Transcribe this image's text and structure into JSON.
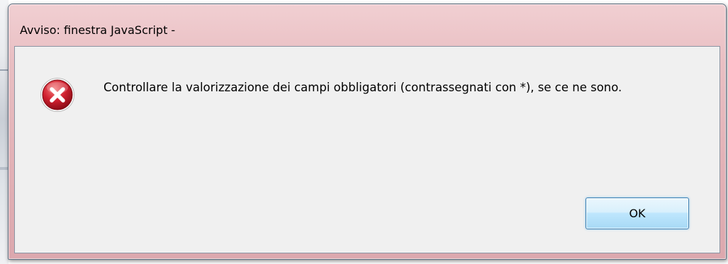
{
  "dialog": {
    "title": "Avviso: finestra JavaScript -",
    "message": "Controllare la valorizzazione dei campi obbligatori (contrassegnati con *), se ce ne sono.",
    "icon": "error-icon",
    "ok_label": "OK"
  },
  "colors": {
    "titlebar": "#e6b8bc",
    "client_background": "#f0f0f0",
    "error_icon_red": "#c8102e",
    "ok_button_border": "#3c7fb1"
  }
}
